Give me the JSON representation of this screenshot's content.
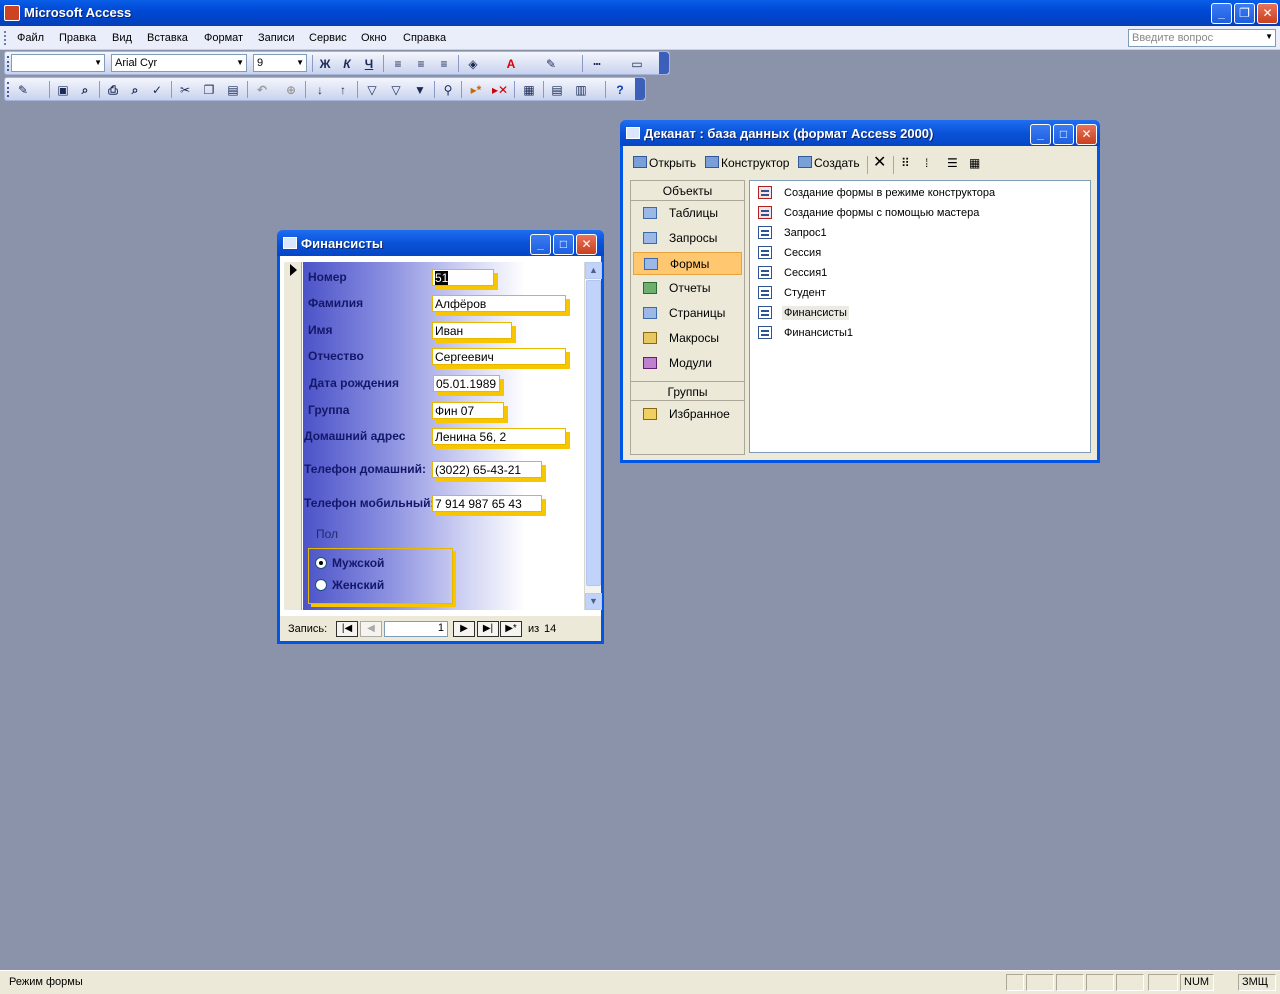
{
  "app": {
    "title": "Microsoft Access",
    "menu": [
      "Файл",
      "Правка",
      "Вид",
      "Вставка",
      "Формат",
      "Записи",
      "Сервис",
      "Окно",
      "Справка"
    ],
    "ask_placeholder": "Введите вопрос"
  },
  "formatting_toolbar": {
    "object_combo": "",
    "font_name": "Arial Cyr",
    "font_size": "9",
    "bold": "Ж",
    "italic": "К",
    "underline": "Ч"
  },
  "status_bar": {
    "text": "Режим формы",
    "num": "NUM",
    "layout": "ЗМЩ"
  },
  "form_window": {
    "title": "Финансисты",
    "fields": [
      {
        "label": "Номер",
        "value": "51"
      },
      {
        "label": "Фамилия",
        "value": "Алфёров"
      },
      {
        "label": "Имя",
        "value": "Иван"
      },
      {
        "label": "Отчество",
        "value": "Сергеевич"
      },
      {
        "label": "Дата рождения",
        "value": "05.01.1989"
      },
      {
        "label": "Группа",
        "value": "Фин 07"
      },
      {
        "label": "Домашний адрес",
        "value": "Ленина 56, 2"
      },
      {
        "label": "Телефон домашний:",
        "value": "(3022) 65-43-21"
      },
      {
        "label": "Телефон мобильный:",
        "value": "7 914 987 65 43"
      }
    ],
    "gender": {
      "label": "Пол",
      "options": [
        {
          "label": "Мужской",
          "selected": true
        },
        {
          "label": "Женский",
          "selected": false
        }
      ]
    },
    "nav": {
      "label": "Запись:",
      "current": "1",
      "of_label": "из",
      "total": "14"
    }
  },
  "db_window": {
    "title": "Деканат : база данных (формат Access 2000)",
    "toolbar": {
      "open": "Открыть",
      "design": "Конструктор",
      "create": "Создать"
    },
    "objects_header": "Объекты",
    "objects": [
      {
        "label": "Таблицы",
        "selected": false
      },
      {
        "label": "Запросы",
        "selected": false
      },
      {
        "label": "Формы",
        "selected": true
      },
      {
        "label": "Отчеты",
        "selected": false
      },
      {
        "label": "Страницы",
        "selected": false
      },
      {
        "label": "Макросы",
        "selected": false
      },
      {
        "label": "Модули",
        "selected": false
      }
    ],
    "groups_header": "Группы",
    "groups": [
      {
        "label": "Избранное"
      }
    ],
    "items": [
      {
        "label": "Создание формы в режиме конструктора",
        "icon": "wizard-icon"
      },
      {
        "label": "Создание формы с помощью мастера",
        "icon": "wizard-icon"
      },
      {
        "label": "Запрос1",
        "icon": "form-icon"
      },
      {
        "label": "Сессия",
        "icon": "form-icon"
      },
      {
        "label": "Сессия1",
        "icon": "form-icon"
      },
      {
        "label": "Студент",
        "icon": "form-icon"
      },
      {
        "label": "Финансисты",
        "icon": "form-icon"
      },
      {
        "label": "Финансисты1",
        "icon": "form-icon"
      }
    ]
  }
}
